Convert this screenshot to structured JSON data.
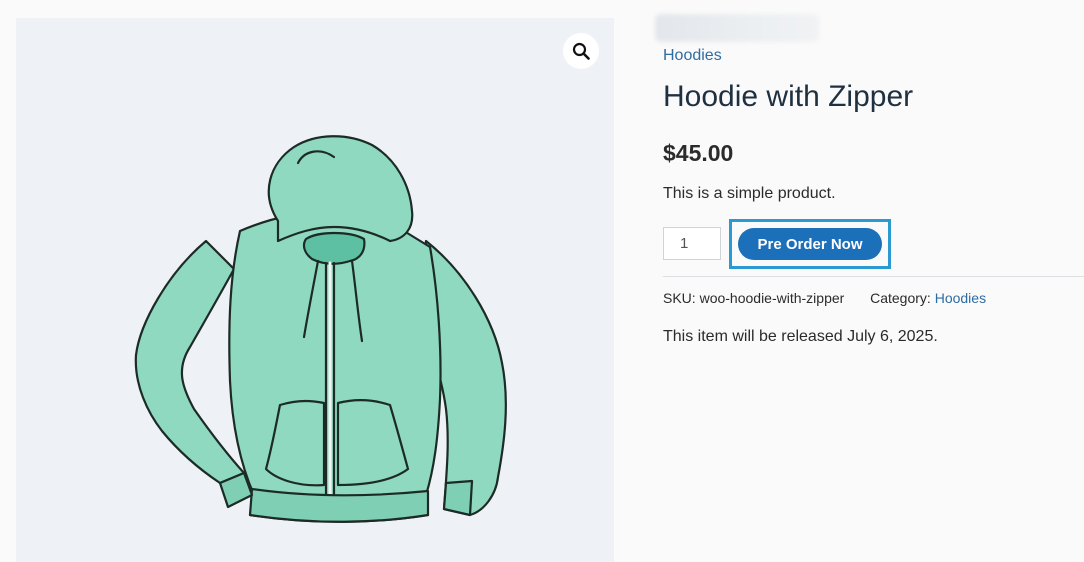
{
  "gallery": {
    "zoom_icon": "magnifier-icon",
    "image_subject": "hoodie-image"
  },
  "colors": {
    "accent": "#1c6fb9",
    "focus_outline": "#2b9ad3",
    "link": "#2e6ca4",
    "hoodie": "#8ed9c0"
  },
  "product": {
    "category_link": "Hoodies",
    "title": "Hoodie with Zipper",
    "price": "$45.00",
    "short_description": "This is a simple product.",
    "quantity": "1",
    "preorder_button": "Pre Order Now",
    "sku_label": "SKU:",
    "sku_value": "woo-hoodie-with-zipper",
    "category_label": "Category:",
    "category_value": "Hoodies",
    "release_note": "This item will be released July 6, 2025."
  }
}
